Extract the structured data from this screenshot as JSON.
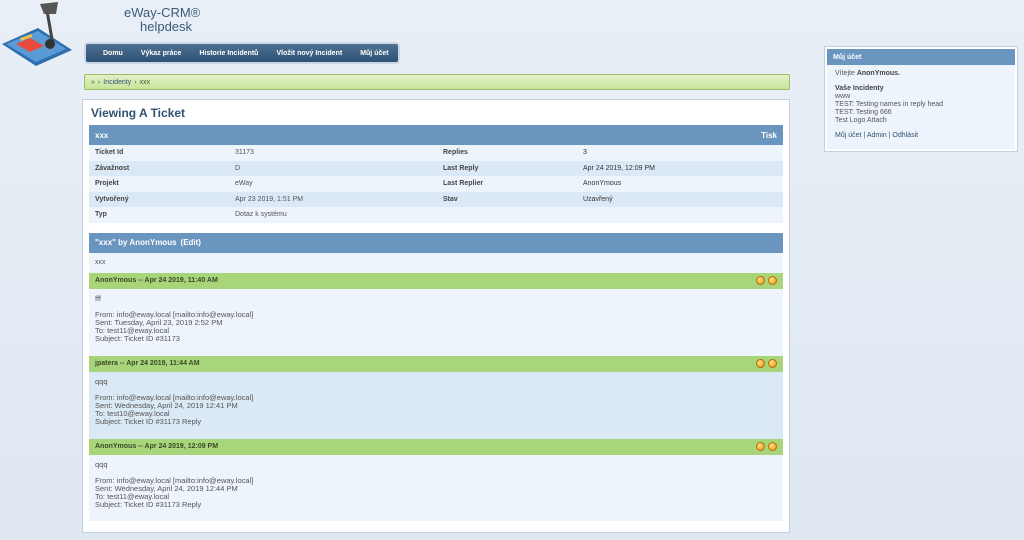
{
  "brand": {
    "name": "eWay-CRM®",
    "sub": "helpdesk"
  },
  "nav": [
    "Domu",
    "Výkaz práce",
    "Historie Incidentů",
    "Vložit nový Incident",
    "Můj účet"
  ],
  "breadcrumb": {
    "sep1": "»",
    "sep2": "›",
    "link": "Incidenty",
    "sep3": "›",
    "current": "xxx"
  },
  "page_title": "Viewing A Ticket",
  "ticket": {
    "subject": "xxx",
    "print": "Tisk",
    "rows": [
      {
        "l1": "Ticket Id",
        "v1": "31173",
        "l2": "Replies",
        "v2": "3"
      },
      {
        "l1": "Závažnost",
        "v1": "D",
        "l2": "Last Reply",
        "v2": "Apr 24 2019, 12:09 PM"
      },
      {
        "l1": "Projekt",
        "v1": "eWay",
        "l2": "Last Replier",
        "v2": "AnonYmous"
      },
      {
        "l1": "Vytvořený",
        "v1": "Apr 23 2019, 1:51 PM",
        "l2": "Stav",
        "v2": "Uzavřený"
      },
      {
        "l1": "Typ",
        "v1": "Dotaz k systému",
        "l2": "",
        "v2": ""
      }
    ]
  },
  "message": {
    "title": "\"xxx\" by AnonYmous",
    "edit": "(Edit)",
    "body": "xxx"
  },
  "replies": [
    {
      "head": "AnonYmous -- Apr 24 2019, 11:40 AM",
      "text": "fff",
      "from": "From: info@eway.local [mailto:info@eway.local]",
      "sent": "Sent: Tuesday, April 23, 2019 2:52 PM",
      "to": "To: test11@eway.local",
      "subject": "Subject: Ticket ID #31173"
    },
    {
      "head": "jpatera -- Apr 24 2019, 11:44 AM",
      "text": "qqq",
      "from": "From: info@eway.local [mailto:info@eway.local]",
      "sent": "Sent: Wednesday, April 24, 2019 12:41 PM",
      "to": "To: test10@eway.local",
      "subject": "Subject: Ticket ID #31173 Reply"
    },
    {
      "head": "AnonYmous -- Apr 24 2019, 12:09 PM",
      "text": "qqq",
      "from": "From: info@eway.local [mailto:info@eway.local]",
      "sent": "Sent: Wednesday, April 24, 2019 12:44 PM",
      "to": "To: test11@eway.local",
      "subject": "Subject: Ticket ID #31173 Reply"
    }
  ],
  "account": {
    "title": "Můj účet",
    "welcome_prefix": "Vítejte",
    "user": "AnonYmous.",
    "incidents_title": "Vaše Incidenty",
    "incidents": [
      "www",
      "TEST: Testing names in reply head",
      "TEST: Testing 666",
      "Test Logo Attach"
    ],
    "links": [
      "Můj účet",
      "Admin",
      "Odhlásit"
    ],
    "link_sep": "|"
  },
  "colors": {
    "header_blue": "#6a95bf",
    "reply_green": "#a8d47a",
    "nav_blue": "#2f5274"
  },
  "icons": [
    "logo-lamp-icon",
    "reply-quote-icon",
    "reply-edit-icon"
  ]
}
